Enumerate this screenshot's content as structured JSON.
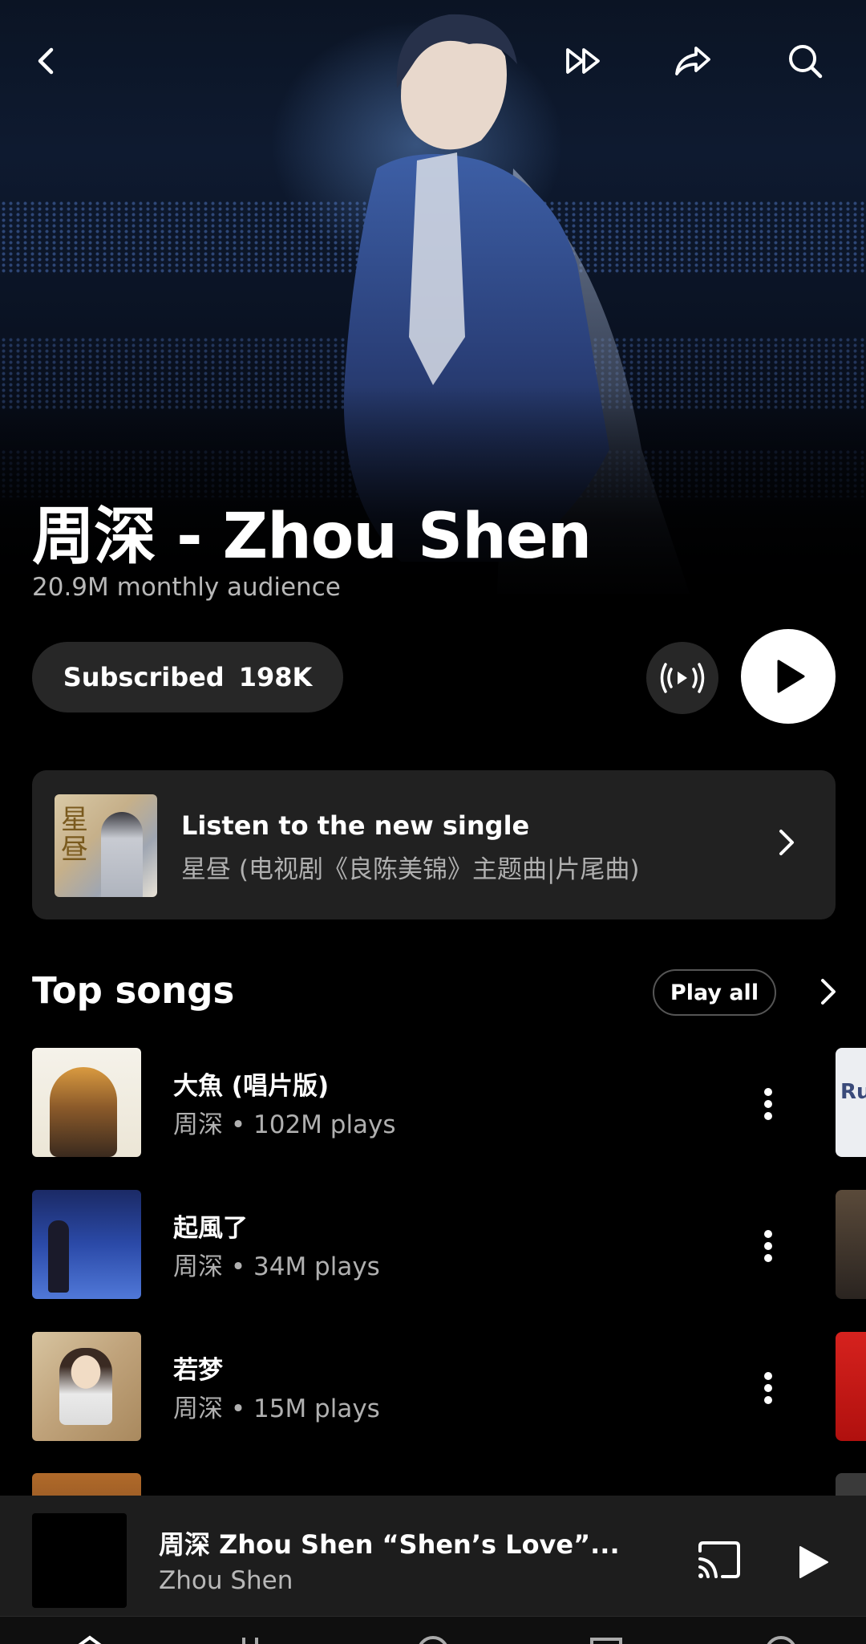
{
  "artist": {
    "name": "周深 - Zhou Shen",
    "audience": "20.9M monthly audience"
  },
  "actions": {
    "subscribe_label": "Subscribed",
    "subscribe_count": "198K"
  },
  "new_single": {
    "heading": "Listen to the new single",
    "title": "星昼 (电视剧《良陈美锦》主题曲|片尾曲)"
  },
  "top_songs": {
    "heading": "Top songs",
    "play_all_label": "Play all",
    "items": [
      {
        "title": "大魚 (唱片版)",
        "subtitle": "周深 • 102M plays"
      },
      {
        "title": "起風了",
        "subtitle": "周深 • 34M plays"
      },
      {
        "title": "若梦",
        "subtitle": "周深 • 15M plays"
      }
    ],
    "peek_items": [
      {
        "text": "Rul"
      }
    ]
  },
  "mini_player": {
    "title": "周深 Zhou Shen “Shen’s Love”...",
    "artist": "Zhou Shen"
  },
  "icons": {
    "back": "chevron-left-icon",
    "shuffle": "fast-forward-icon",
    "share": "share-arrow-icon",
    "search": "search-icon",
    "radio": "radio-broadcast-icon",
    "play": "play-icon",
    "more": "more-vertical-icon",
    "cast": "cast-icon"
  },
  "colors": {
    "background": "#000000",
    "surface": "#212121",
    "button": "#272727",
    "text_secondary": "#b0b0b0",
    "play_button": "#ffffff"
  }
}
